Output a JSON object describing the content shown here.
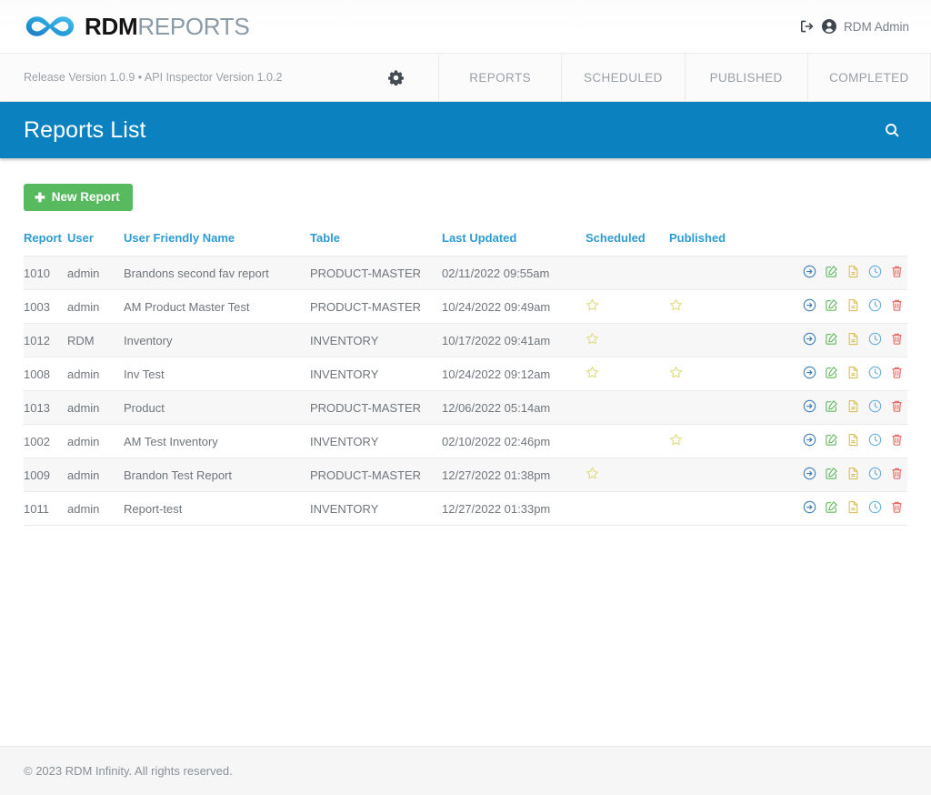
{
  "brand": {
    "logo_icon": "infinity-icon",
    "name_bold": "RDM",
    "name_light": "REPORTS",
    "accent_blue": "#29a3dc"
  },
  "header": {
    "signout_icon": "sign-out-icon",
    "user_icon": "user-circle-icon",
    "user_name": "RDM Admin"
  },
  "subnav": {
    "version_text": "Release Version 1.0.9 • API Inspector Version 1.0.2",
    "settings_icon": "gear-icon",
    "tabs": [
      {
        "label": "REPORTS"
      },
      {
        "label": "SCHEDULED"
      },
      {
        "label": "PUBLISHED"
      },
      {
        "label": "COMPLETED"
      }
    ]
  },
  "banner": {
    "title": "Reports List",
    "search_icon": "search-icon",
    "color": "#0b81c0"
  },
  "toolbar": {
    "new_report_label": "New Report",
    "new_report_icon": "plus-icon",
    "new_report_color": "#57ba5e"
  },
  "table": {
    "headers": [
      "Report",
      "User",
      "User Friendly Name",
      "Table",
      "Last Updated",
      "Scheduled",
      "Published"
    ],
    "row_actions": [
      {
        "icon": "arrow-circle-right-icon",
        "name": "run-report-action",
        "color": "#3f7fb5"
      },
      {
        "icon": "edit-square-icon",
        "name": "edit-report-action",
        "color": "#62b85f"
      },
      {
        "icon": "file-icon",
        "name": "copy-report-action",
        "color": "#d9c05a"
      },
      {
        "icon": "clock-icon",
        "name": "schedule-report-action",
        "color": "#65aede"
      },
      {
        "icon": "trash-icon",
        "name": "delete-report-action",
        "color": "#e4655f"
      }
    ],
    "star_icon": "star-icon",
    "rows": [
      {
        "report": "1010",
        "user": "admin",
        "name": "Brandons second fav report",
        "table": "PRODUCT-MASTER",
        "updated": "02/11/2022 09:55am",
        "scheduled": false,
        "published": false
      },
      {
        "report": "1003",
        "user": "admin",
        "name": "AM Product Master Test",
        "table": "PRODUCT-MASTER",
        "updated": "10/24/2022 09:49am",
        "scheduled": true,
        "published": true
      },
      {
        "report": "1012",
        "user": "RDM",
        "name": "Inventory",
        "table": "INVENTORY",
        "updated": "10/17/2022 09:41am",
        "scheduled": true,
        "published": false
      },
      {
        "report": "1008",
        "user": "admin",
        "name": "Inv Test",
        "table": "INVENTORY",
        "updated": "10/24/2022 09:12am",
        "scheduled": true,
        "published": true
      },
      {
        "report": "1013",
        "user": "admin",
        "name": "Product",
        "table": "PRODUCT-MASTER",
        "updated": "12/06/2022 05:14am",
        "scheduled": false,
        "published": false
      },
      {
        "report": "1002",
        "user": "admin",
        "name": "AM Test Inventory",
        "table": "INVENTORY",
        "updated": "02/10/2022 02:46pm",
        "scheduled": false,
        "published": true
      },
      {
        "report": "1009",
        "user": "admin",
        "name": "Brandon Test Report",
        "table": "PRODUCT-MASTER",
        "updated": "12/27/2022 01:38pm",
        "scheduled": true,
        "published": false
      },
      {
        "report": "1011",
        "user": "admin",
        "name": "Report-test",
        "table": "INVENTORY",
        "updated": "12/27/2022 01:33pm",
        "scheduled": false,
        "published": false
      }
    ]
  },
  "footer": {
    "copyright": "© 2023 RDM Infinity. All rights reserved."
  }
}
